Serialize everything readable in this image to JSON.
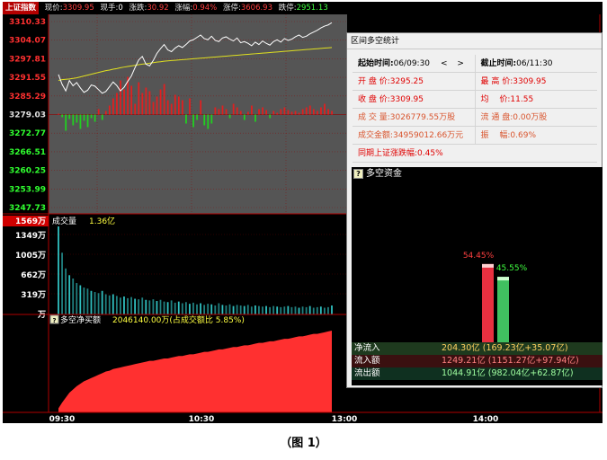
{
  "quote_bar": {
    "index_name": "上证指数",
    "items": [
      {
        "label": "现价:",
        "value": "3309.95",
        "color": "red"
      },
      {
        "label": "现手:",
        "value": "0",
        "color": "white"
      },
      {
        "label": "涨跌:",
        "value": "30.92",
        "color": "red"
      },
      {
        "label": "涨幅:",
        "value": "0.94%",
        "color": "red"
      },
      {
        "label": "涨停:",
        "value": "3606.93",
        "color": "red"
      },
      {
        "label": "跌停:",
        "value": "2951.13",
        "color": "green"
      }
    ]
  },
  "price_axis": {
    "labels": [
      "3310.33",
      "3304.07",
      "3297.81",
      "3291.55",
      "3285.29",
      "3279.03",
      "3272.77",
      "3266.51",
      "3260.25",
      "3253.99",
      "3247.73"
    ],
    "colors": [
      "#ff3030",
      "#ff3030",
      "#ff3030",
      "#ff3030",
      "#ff3030",
      "#e0e0e0",
      "#30ff30",
      "#30ff30",
      "#30ff30",
      "#30ff30",
      "#30ff30"
    ]
  },
  "volume_panel": {
    "title": "成交量",
    "total": "1.36亿",
    "axis_top": "1569万",
    "axis_labels": [
      "1349万",
      "1005万",
      "662万",
      "319万",
      "万"
    ]
  },
  "net_buy_panel": {
    "title": "多空净买额",
    "value": "2046140.00万(占成交额比 5.85%)"
  },
  "time_axis": [
    "09:30",
    "10:30",
    "13:00",
    "14:00"
  ],
  "stats_window": {
    "title": "区间多空统计",
    "start_label": "起始时间:",
    "start_value": "06/09:30",
    "nav": "< >",
    "end_label": "截止时间:",
    "end_value": "06/11:30",
    "rows": [
      {
        "left_k": "开 盘 价:",
        "left_v": "3295.25",
        "right_k": "最 高 价:",
        "right_v": "3309.95",
        "style": "red"
      },
      {
        "left_k": "收 盘 价:",
        "left_v": "3309.95",
        "right_k": "均　 价:",
        "right_v": "11.55",
        "style": "red"
      },
      {
        "left_k": "成 交 量:",
        "left_v": "3026779.55万股",
        "right_k": "流 通 盘:",
        "right_v": "0.00万股",
        "style": "orange"
      },
      {
        "left_k": "成交金额:",
        "left_v": "34959012.66万元",
        "right_k": "振　 幅:",
        "right_v": "0.69%",
        "style": "orange"
      }
    ],
    "index_change": "同期上证涨跌幅:0.45%"
  },
  "flow_panel": {
    "title": "多空资金",
    "inflow_pct": "54.45%",
    "outflow_pct": "45.55%",
    "inflow_label": "流入",
    "outflow_label": "流出",
    "inflow_ratio": 54.45,
    "outflow_ratio": 45.55,
    "rows": [
      {
        "label": "净流入",
        "value": "204.30亿 (169.23亿+35.07亿)",
        "cls": "net"
      },
      {
        "label": "流入额",
        "value": "1249.21亿 (1151.27亿+97.94亿)",
        "cls": "in"
      },
      {
        "label": "流出额",
        "value": "1044.91亿 (982.04亿+62.87亿)",
        "cls": "out"
      }
    ]
  },
  "caption": "（图 1）",
  "colors": {
    "up": "#ff3030",
    "down": "#30ff30",
    "price_line": "#ffffff",
    "avg_line": "#e0e020",
    "grid": "#5a0000",
    "cyan_bar": "#30c0c0",
    "chart_bg": "#555555"
  },
  "price_line": [
    3292.5,
    3289.2,
    3287.0,
    3290.5,
    3288.7,
    3289.8,
    3288.0,
    3286.5,
    3287.2,
    3289.0,
    3288.6,
    3287.4,
    3286.2,
    3286.8,
    3288.4,
    3290.0,
    3288.8,
    3287.0,
    3288.2,
    3290.2,
    3292.0,
    3294.8,
    3297.4,
    3298.6,
    3296.0,
    3295.4,
    3297.2,
    3299.6,
    3301.2,
    3302.6,
    3300.8,
    3300.2,
    3301.4,
    3302.2,
    3301.6,
    3302.6,
    3303.8,
    3304.2,
    3305.0,
    3305.8,
    3304.6,
    3304.2,
    3305.4,
    3304.0,
    3303.6,
    3304.8,
    3305.2,
    3304.4,
    3303.8,
    3304.8,
    3303.2,
    3303.6,
    3303.0,
    3302.2,
    3303.4,
    3302.6,
    3303.8,
    3303.0,
    3302.4,
    3303.6,
    3304.2,
    3303.4,
    3304.6,
    3304.0,
    3304.4,
    3305.2,
    3305.8,
    3305.0,
    3305.4,
    3306.2,
    3306.8,
    3307.4,
    3308.2,
    3308.8,
    3309.2,
    3309.95
  ],
  "avg_line": [
    3290.5,
    3290.8,
    3290.9,
    3291.0,
    3291.2,
    3291.4,
    3291.7,
    3292.0,
    3292.3,
    3292.6,
    3292.9,
    3293.2,
    3293.5,
    3293.8,
    3294.0,
    3294.3,
    3294.5,
    3294.8,
    3295.0,
    3295.2,
    3295.4,
    3295.6,
    3295.8,
    3296.0,
    3296.1,
    3296.3,
    3296.5,
    3296.7,
    3296.8,
    3297.0,
    3297.1,
    3297.2,
    3297.3,
    3297.4,
    3297.5,
    3297.6,
    3297.7,
    3297.8,
    3297.9,
    3298.0,
    3298.1,
    3298.2,
    3298.3,
    3298.4,
    3298.5,
    3298.6,
    3298.7,
    3298.8,
    3298.9,
    3299.0,
    3299.1,
    3299.2,
    3299.3,
    3299.4,
    3299.5,
    3299.6,
    3299.7,
    3299.8,
    3299.9,
    3300.0,
    3300.1,
    3300.2,
    3300.3,
    3300.4,
    3300.5,
    3300.6,
    3300.7,
    3300.8,
    3300.9,
    3301.0,
    3301.1,
    3301.2,
    3301.3,
    3301.4,
    3301.5,
    3301.6
  ],
  "buy_sell_bars": [
    0.1,
    -0.3,
    -1.8,
    -0.5,
    -1.2,
    -0.9,
    -1.6,
    -0.7,
    -1.4,
    -0.4,
    -0.8,
    0.6,
    -0.6,
    0.4,
    1.0,
    1.8,
    2.4,
    3.8,
    2.8,
    4.2,
    3.2,
    1.2,
    3.6,
    2.4,
    3.0,
    2.6,
    1.4,
    2.0,
    2.8,
    3.4,
    1.6,
    1.2,
    2.2,
    2.0,
    1.6,
    -1.0,
    1.8,
    -1.4,
    -0.6,
    1.6,
    -1.2,
    -1.6,
    -1.0,
    0.8,
    0.6,
    1.0,
    0.6,
    -0.4,
    1.2,
    0.8,
    0.4,
    -0.6,
    0.3,
    1.0,
    -0.8,
    0.6,
    0.8,
    0.5,
    -0.4,
    0.4,
    0.2,
    0.6,
    0.8,
    0.5,
    0.3,
    0.4,
    0.2,
    0.6,
    0.8,
    1.0,
    0.6,
    0.4,
    0.8,
    1.2,
    0.6,
    0.4
  ],
  "volume_bars": [
    1569,
    1100,
    820,
    700,
    640,
    560,
    520,
    480,
    460,
    420,
    400,
    380,
    420,
    360,
    340,
    360,
    330,
    300,
    320,
    290,
    310,
    280,
    270,
    300,
    260,
    250,
    270,
    240,
    260,
    230,
    220,
    250,
    210,
    230,
    200,
    220,
    190,
    210,
    180,
    200,
    170,
    190,
    180,
    160,
    200,
    170,
    160,
    180,
    150,
    170,
    160,
    150,
    170,
    140,
    160,
    150,
    140,
    150,
    130,
    150,
    140,
    130,
    140,
    150,
    130,
    140,
    120,
    140,
    130,
    150,
    120,
    130,
    140,
    120,
    130,
    160
  ],
  "net_buy_curve": [
    0.05,
    0.12,
    0.18,
    0.24,
    0.28,
    0.32,
    0.35,
    0.38,
    0.4,
    0.42,
    0.44,
    0.46,
    0.48,
    0.5,
    0.51,
    0.53,
    0.54,
    0.55,
    0.56,
    0.57,
    0.58,
    0.59,
    0.6,
    0.61,
    0.62,
    0.63,
    0.63,
    0.64,
    0.65,
    0.66,
    0.66,
    0.67,
    0.68,
    0.69,
    0.69,
    0.7,
    0.71,
    0.71,
    0.72,
    0.73,
    0.74,
    0.74,
    0.75,
    0.76,
    0.77,
    0.77,
    0.78,
    0.79,
    0.8,
    0.8,
    0.81,
    0.82,
    0.82,
    0.83,
    0.84,
    0.85,
    0.85,
    0.86,
    0.87,
    0.87,
    0.88,
    0.89,
    0.9,
    0.9,
    0.91,
    0.92,
    0.93,
    0.93,
    0.94,
    0.95,
    0.96,
    0.96,
    0.97,
    0.98,
    0.99,
    1.0
  ]
}
